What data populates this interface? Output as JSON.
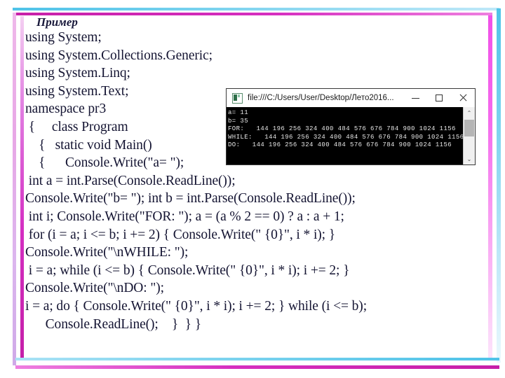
{
  "slide": {
    "title": "Пример",
    "code_lines": [
      "using System;",
      "using System.Collections.Generic;",
      "using System.Linq;",
      "using System.Text;",
      "namespace pr3",
      " {     class Program",
      "    {   static void Main()",
      "    {      Console.Write(\"a= \");",
      " int a = int.Parse(Console.ReadLine());",
      "Console.Write(\"b= \"); int b = int.Parse(Console.ReadLine());",
      " int i; Console.Write(\"FOR: \"); a = (a % 2 == 0) ? a : a + 1;",
      " for (i = a; i <= b; i += 2) { Console.Write(\" {0}\", i * i); }",
      "Console.Write(\"\\nWHILE: \");",
      " i = a; while (i <= b) { Console.Write(\" {0}\", i * i); i += 2; }",
      "Console.Write(\"\\nDO: \");",
      "i = a; do { Console.Write(\" {0}\", i * i); i += 2; } while (i <= b);",
      "      Console.ReadLine();    }  } }"
    ]
  },
  "console_window": {
    "title": "file:///C:/Users/User/Desktop/Лето2016...",
    "minimize_label": "—",
    "maximize_label": "□",
    "close_label": "✕",
    "scroll_up_label": "⌃",
    "scroll_down_label": "⌄",
    "output_lines": [
      "a= 11",
      "b= 35",
      "FOR:   144 196 256 324 400 484 576 676 784 900 1024 1156",
      "WHILE:   144 196 256 324 400 484 576 676 784 900 1024 1156",
      "DO:   144 196 256 324 400 484 576 676 784 900 1024 1156"
    ]
  },
  "colors": {
    "accent_cyan": "#4fc3e8",
    "accent_magenta": "#c71fa8",
    "text": "#141432",
    "console_bg": "#000000"
  }
}
